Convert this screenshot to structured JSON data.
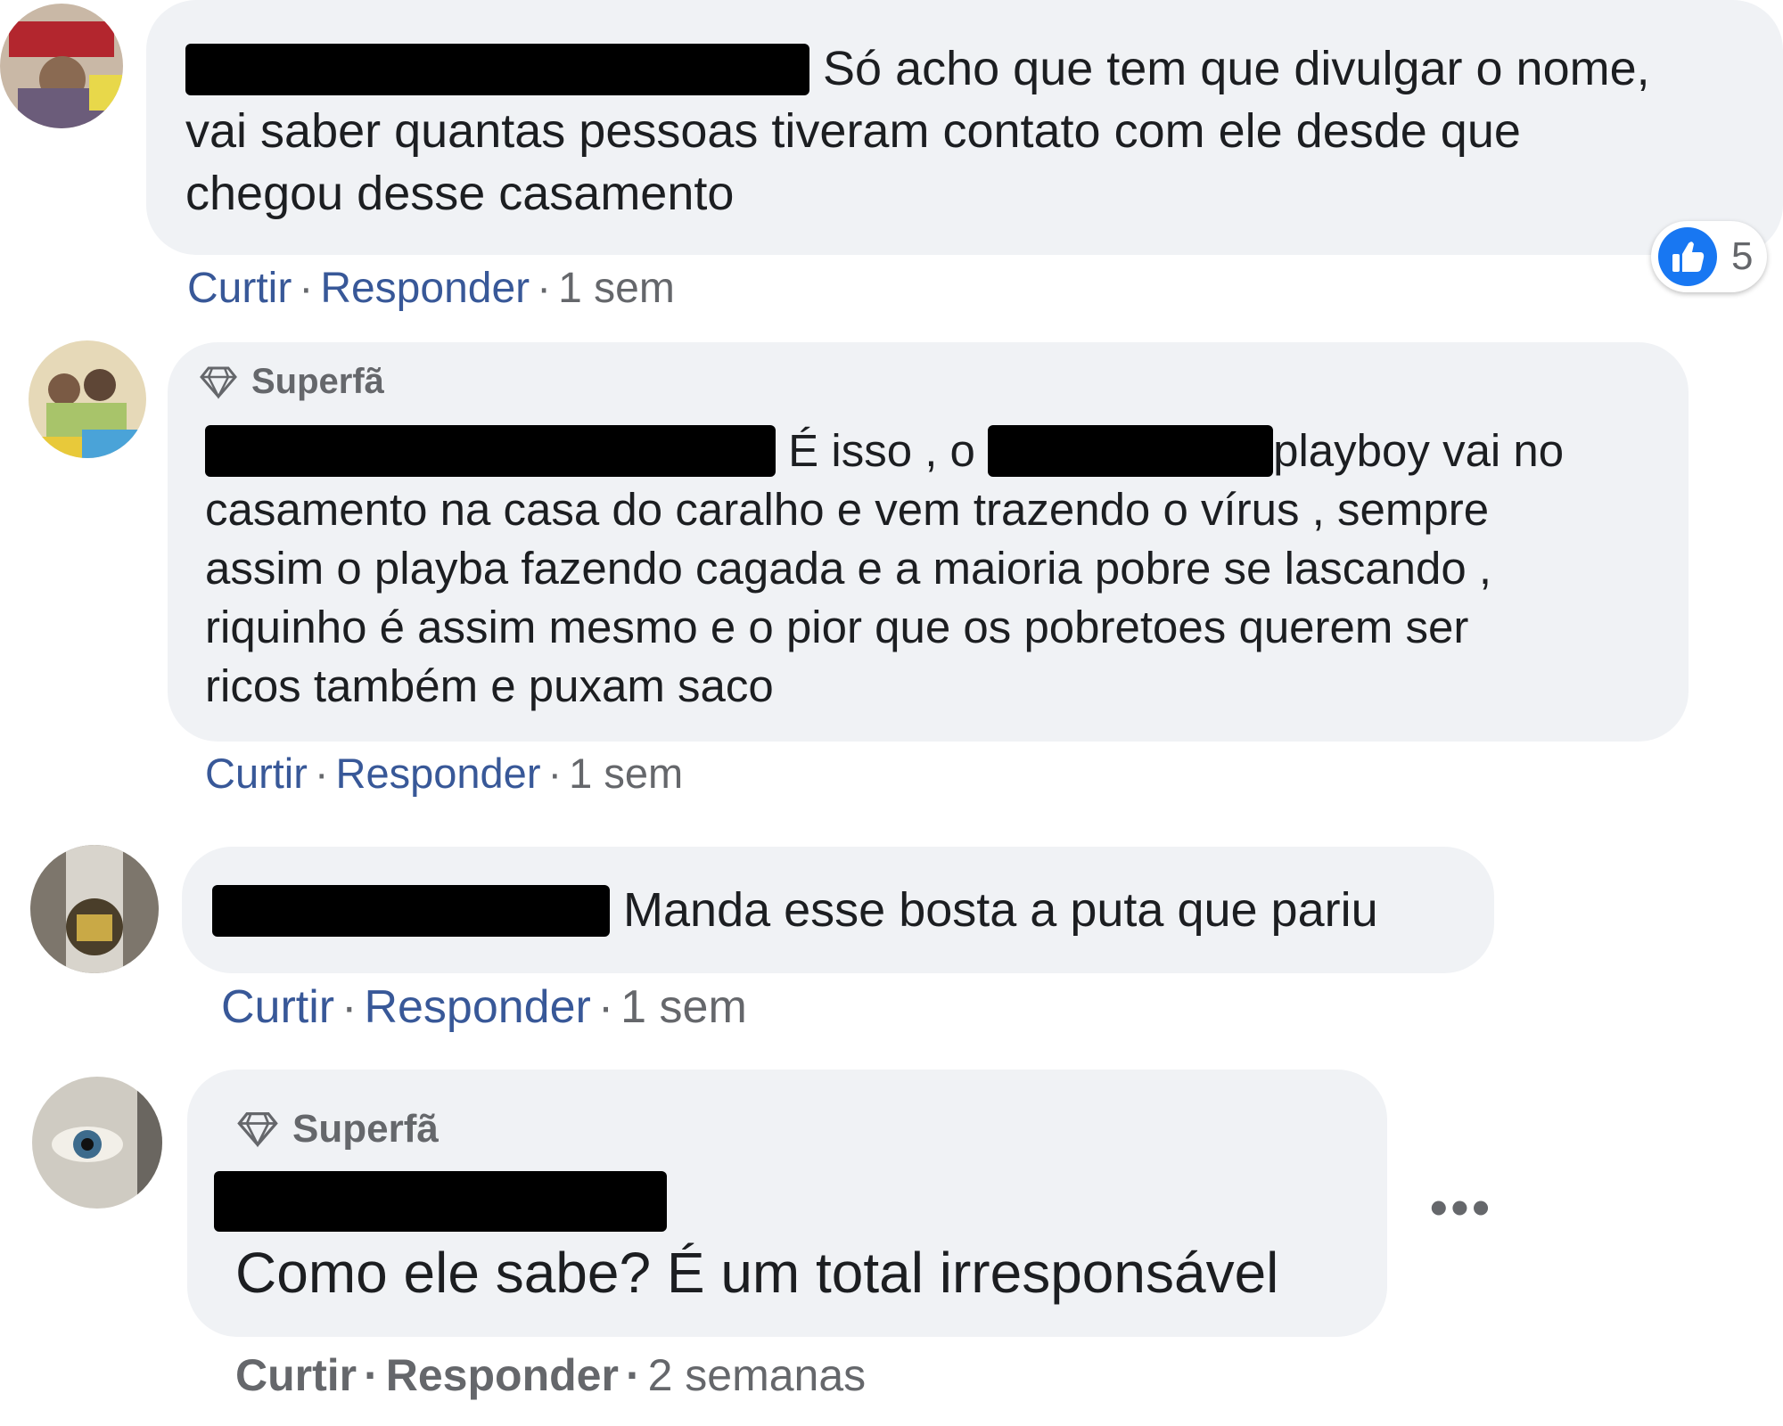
{
  "comments": [
    {
      "text_line1": "Só acho que tem que divulgar o nome,",
      "text_line2": "vai saber quantas pessoas tiveram contato com ele desde que",
      "text_line3": "chegou desse casamento",
      "like": "Curtir",
      "reply": "Responder",
      "time": "1 sem",
      "reactions": "5"
    },
    {
      "badge": "Superfã",
      "text_a": "É isso , o",
      "text_b": "playboy vai no",
      "text_line2": "casamento na casa do caralho e vem trazendo o vírus , sempre",
      "text_line3": "assim o playba fazendo cagada e a maioria pobre se lascando ,",
      "text_line4": "riquinho é assim mesmo e o pior que os pobretoes querem ser",
      "text_line5": "ricos também e puxam saco",
      "like": "Curtir",
      "reply": "Responder",
      "time": "1 sem"
    },
    {
      "text_line1": "Manda esse bosta a puta que pariu",
      "like": "Curtir",
      "reply": "Responder",
      "time": "1 sem"
    },
    {
      "badge": "Superfã",
      "text_line1": "Como ele sabe? É um total irresponsável",
      "like": "Curtir",
      "reply": "Responder",
      "time": "2 semanas"
    }
  ],
  "icons": {
    "like": "thumbs-up-icon",
    "badge": "diamond-icon",
    "more": "more-options-icon"
  },
  "colors": {
    "bubble": "#f0f2f5",
    "link": "#385898",
    "meta": "#65676b",
    "like_blue": "#1877f2"
  }
}
